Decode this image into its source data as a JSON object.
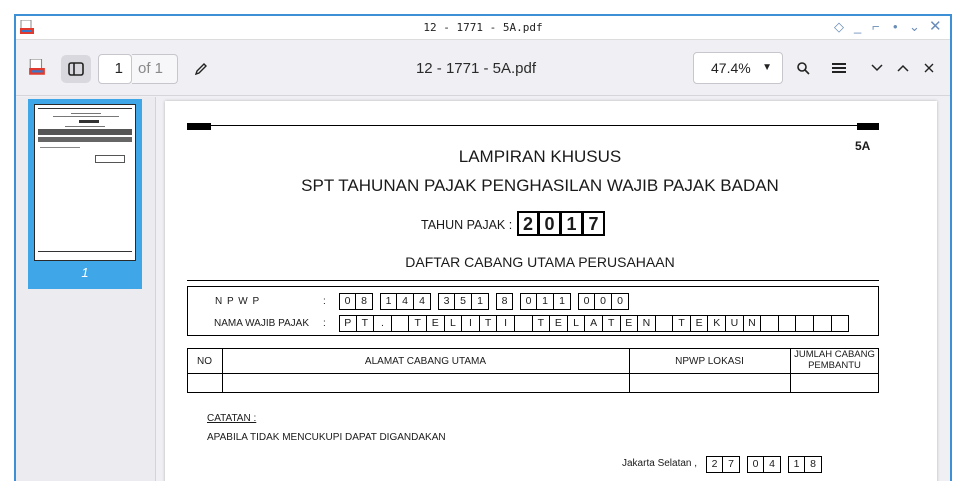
{
  "window": {
    "title": "12 - 1771 - 5A.pdf"
  },
  "toolbar": {
    "page_number": "1",
    "page_total": "of 1",
    "document_title": "12 - 1771 - 5A.pdf",
    "zoom": "47.4%"
  },
  "sidebar": {
    "thumbnail_label": "1"
  },
  "document": {
    "heading1": "LAMPIRAN KHUSUS",
    "heading2": "SPT TAHUNAN PAJAK PENGHASILAN WAJIB PAJAK BADAN",
    "form_code": "5A",
    "tahun_label": "TAHUN PAJAK :",
    "tahun_digits": [
      "2",
      "0",
      "1",
      "7"
    ],
    "section_title": "DAFTAR CABANG UTAMA PERUSAHAAN",
    "npwp_label": "N P W P",
    "npwp_colon": ":",
    "npwp_groups": [
      [
        "0",
        "8"
      ],
      [
        "1",
        "4",
        "4"
      ],
      [
        "3",
        "5",
        "1"
      ],
      [
        "8"
      ],
      [
        "0",
        "1",
        "1"
      ],
      [
        "0",
        "0",
        "0"
      ]
    ],
    "nama_label": "NAMA WAJIB PAJAK",
    "nama_colon": ":",
    "nama_chars": [
      "P",
      "T",
      ".",
      " ",
      "T",
      "E",
      "L",
      "I",
      "T",
      "I",
      " ",
      "T",
      "E",
      "L",
      "A",
      "T",
      "E",
      "N",
      " ",
      "T",
      "E",
      "K",
      "U",
      "N",
      " ",
      " ",
      " ",
      " ",
      ""
    ],
    "table_headers": [
      "NO",
      "ALAMAT CABANG UTAMA",
      "NPWP LOKASI",
      "JUMLAH CABANG PEMBANTU"
    ],
    "catatan_label": "CATATAN :",
    "catatan_text": "APABILA TIDAK MENCUKUPI DAPAT DIGANDAKAN",
    "place": "Jakarta Selatan ,",
    "date_groups": [
      [
        "2",
        "7"
      ],
      [
        "0",
        "4"
      ],
      [
        "1",
        "8"
      ]
    ]
  }
}
